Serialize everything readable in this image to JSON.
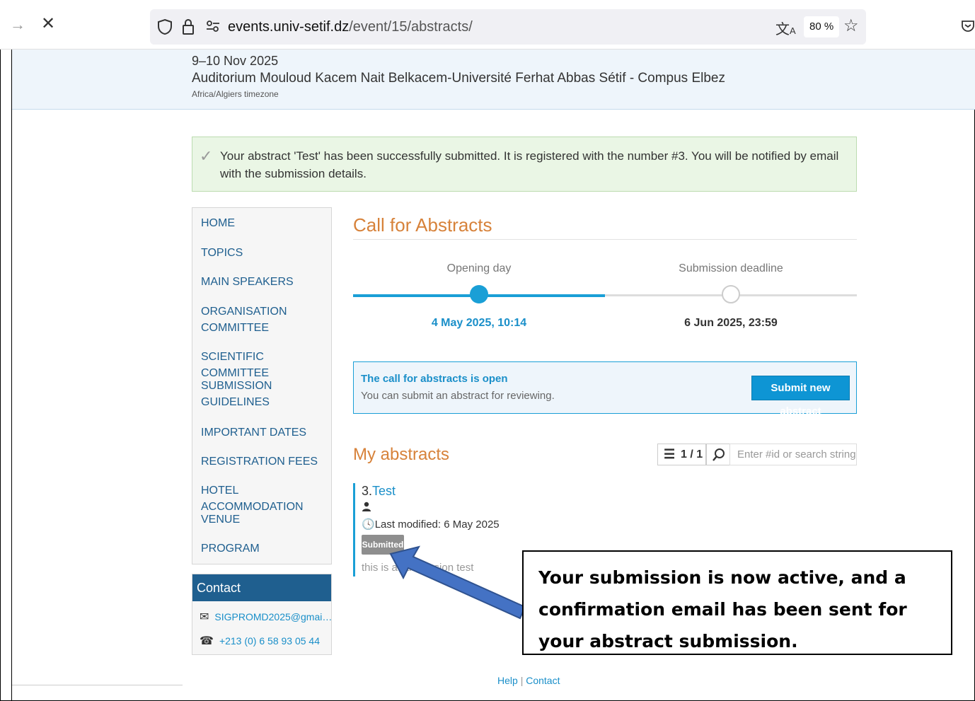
{
  "browser": {
    "url_host": "events.univ-setif.dz",
    "url_path": "/event/15/abstracts/",
    "zoom": "80 %"
  },
  "event": {
    "dates": "9–10 Nov 2025",
    "venue": "Auditorium Mouloud Kacem Nait Belkacem-Université Ferhat Abbas Sétif - Compus Elbez",
    "timezone": "Africa/Algiers timezone"
  },
  "success_message": "Your abstract 'Test' has been successfully submitted. It is registered with the number #3. You will be notified by email with the submission details.",
  "menu": {
    "items": [
      "HOME",
      "TOPICS",
      "MAIN SPEAKERS",
      "ORGANISATION COMMITTEE",
      "SCIENTIFIC COMMITTEE",
      "SUBMISSION GUIDELINES",
      "IMPORTANT DATES",
      "REGISTRATION FEES",
      "HOTEL ACCOMMODATION",
      "VENUE",
      "PROGRAM"
    ]
  },
  "contact": {
    "title": "Contact",
    "email": "SIGPROMD2025@gmai…",
    "phone": "+213 (0) 6 58 93 05 44"
  },
  "cfa": {
    "title": "Call for Abstracts",
    "opening_label": "Opening day",
    "opening_date": "4 May 2025, 10:14",
    "deadline_label": "Submission deadline",
    "deadline_date": "6 Jun 2025, 23:59",
    "open_title": "The call for abstracts is open",
    "open_sub": "You can submit an abstract for reviewing.",
    "submit_label": "Submit new abstract"
  },
  "my_abstracts": {
    "title": "My abstracts",
    "count": "1 / 1",
    "search_placeholder": "Enter #id or search string",
    "items": [
      {
        "number": "3.",
        "title": "Test",
        "modified": "Last modified: 6 May 2025",
        "status": "Submitted",
        "description": "this is a submission test"
      }
    ]
  },
  "callout": "Your submission is now active, and a confirmation email has been sent for your abstract submission.",
  "footer": {
    "help": "Help",
    "sep": "|",
    "contact": "Contact"
  }
}
